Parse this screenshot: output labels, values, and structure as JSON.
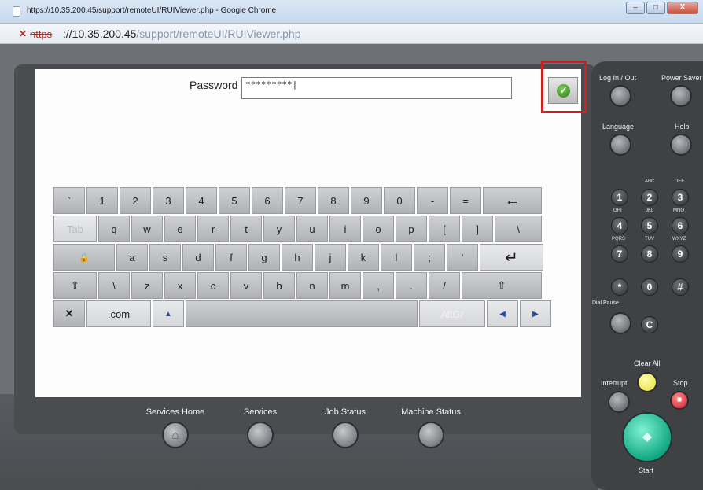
{
  "browser": {
    "tab_title": "https://10.35.200.45/support/remoteUI/RUIViewer.php - Google Chrome",
    "protocol": "https",
    "url_host": "://10.35.200.45",
    "url_path": "/support/remoteUI/RUIViewer.php",
    "window_buttons": {
      "minimize": "–",
      "maximize": "□",
      "close": "X"
    },
    "insecure_mark": "✕"
  },
  "login": {
    "password_label": "Password",
    "password_value": "*********|",
    "ok_icon": "check-icon"
  },
  "keyboard": {
    "row1": [
      "`",
      "1",
      "2",
      "3",
      "4",
      "5",
      "6",
      "7",
      "8",
      "9",
      "0",
      "-",
      "=",
      "←"
    ],
    "row2": [
      "Tab",
      "q",
      "w",
      "e",
      "r",
      "t",
      "y",
      "u",
      "i",
      "o",
      "p",
      "[",
      "]",
      "\\"
    ],
    "row3": [
      "🔒",
      "a",
      "s",
      "d",
      "f",
      "g",
      "h",
      "j",
      "k",
      "l",
      ";",
      "'",
      "↵"
    ],
    "row4": [
      "⇧",
      "\\",
      "z",
      "x",
      "c",
      "v",
      "b",
      "n",
      "m",
      ",",
      ".",
      "/",
      "⇧"
    ],
    "row5": {
      "cancel": "✕",
      "com": ".com",
      "up": "▲",
      "space": "",
      "altgr": "AltGr",
      "left": "◀",
      "right": "▶"
    }
  },
  "bottom_buttons": {
    "services_home": "Services Home",
    "services": "Services",
    "job_status": "Job Status",
    "machine_status": "Machine Status",
    "home_icon": "⌂"
  },
  "right_panel": {
    "log_in_out": "Log In / Out",
    "power_saver": "Power Saver",
    "language": "Language",
    "help": "Help",
    "keypad": [
      {
        "key": "1",
        "sub": ""
      },
      {
        "key": "2",
        "sub": "ABC"
      },
      {
        "key": "3",
        "sub": "DEF"
      },
      {
        "key": "4",
        "sub": "GHI"
      },
      {
        "key": "5",
        "sub": "JKL"
      },
      {
        "key": "6",
        "sub": "MNO"
      },
      {
        "key": "7",
        "sub": "PQRS"
      },
      {
        "key": "8",
        "sub": "TUV"
      },
      {
        "key": "9",
        "sub": "WXYZ"
      },
      {
        "key": "*",
        "sub": ""
      },
      {
        "key": "0",
        "sub": ""
      },
      {
        "key": "#",
        "sub": ""
      }
    ],
    "dial_pause": "Dial Pause",
    "c_key": "C",
    "clear_all": "Clear All",
    "interrupt": "Interrupt",
    "stop": "Stop",
    "start": "Start"
  }
}
